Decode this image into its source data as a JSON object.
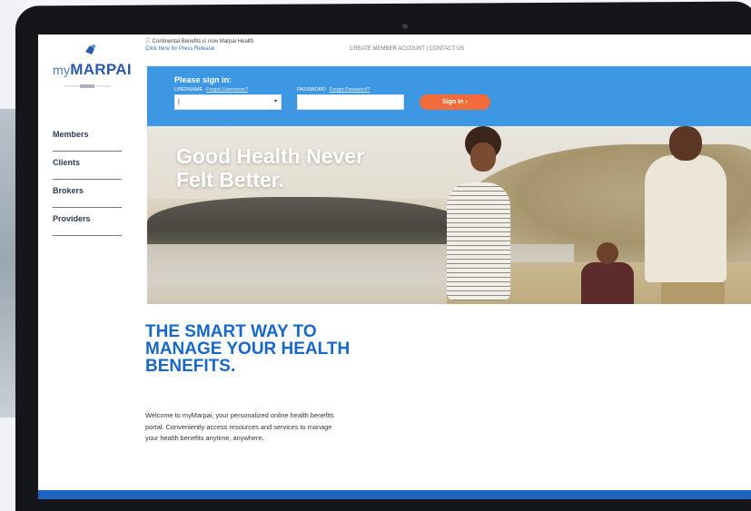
{
  "brand": {
    "logo_text": "MARPAI",
    "logo_prefix": "my",
    "accent": "#2a5ba8",
    "login_band_color": "#3d97e3",
    "signin_color": "#f26b3a",
    "headline_color": "#1768c9"
  },
  "notice": {
    "text": "Continental Benefits is now Marpai Health",
    "link": "Click here for Press Release"
  },
  "top_links": {
    "create_account": "CREATE MEMBER ACCOUNT",
    "separator": "|",
    "contact": "CONTACT US"
  },
  "sidebar": {
    "items": [
      {
        "label": "Members"
      },
      {
        "label": "Clients"
      },
      {
        "label": "Brokers"
      },
      {
        "label": "Providers"
      }
    ]
  },
  "login": {
    "title": "Please sign in:",
    "username_label": "USERNAME",
    "forgot_username": "Forgot Username?",
    "password_label": "PASSWORD",
    "forgot_password": "Forgot Password?",
    "signin_label": "Sign In ›"
  },
  "hero": {
    "title": "Good Health Never Felt Better."
  },
  "main": {
    "headline": "THE SMART WAY TO MANAGE YOUR HEALTH BENEFITS.",
    "intro": "Welcome to myMarpai, your personalized online health benefits portal. Conveniently access resources and services to manage your health benefits anytime, anywhere."
  }
}
